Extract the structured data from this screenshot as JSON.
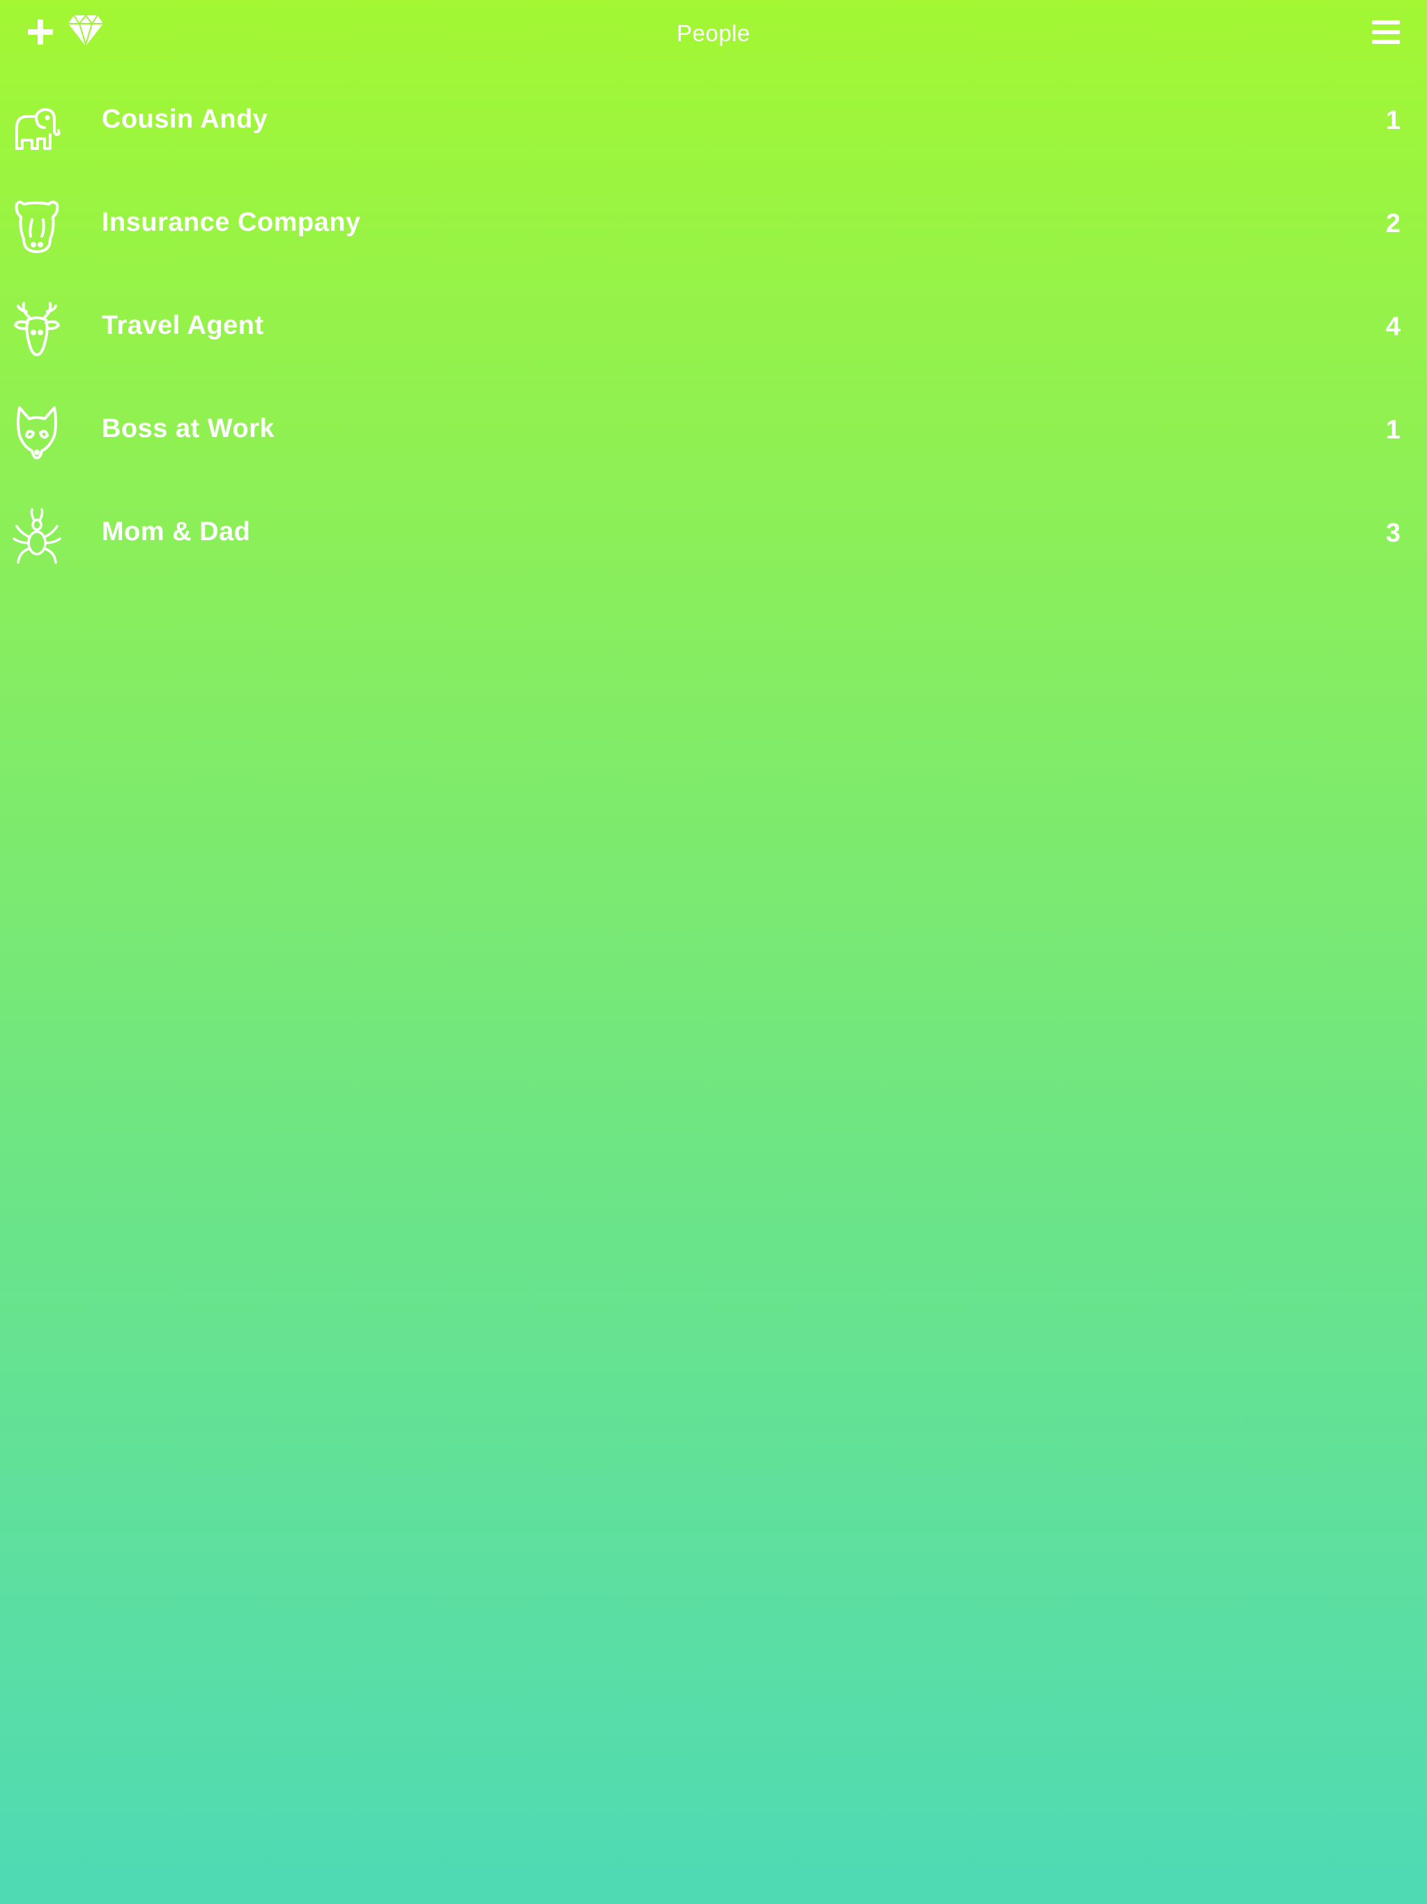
{
  "header": {
    "title": "People",
    "add_icon": "plus-icon",
    "premium_icon": "diamond-icon",
    "menu_icon": "hamburger-menu-icon"
  },
  "colors": {
    "gradient_top": "#a3f733",
    "gradient_bottom": "#4fdab5",
    "text": "#ffffff"
  },
  "people": [
    {
      "name": "Cousin Andy",
      "count": "1",
      "icon": "elephant-icon"
    },
    {
      "name": "Insurance Company",
      "count": "2",
      "icon": "hippo-icon"
    },
    {
      "name": "Travel Agent",
      "count": "4",
      "icon": "deer-icon"
    },
    {
      "name": "Boss at Work",
      "count": "1",
      "icon": "fox-icon"
    },
    {
      "name": "Mom & Dad",
      "count": "3",
      "icon": "spider-icon"
    }
  ]
}
